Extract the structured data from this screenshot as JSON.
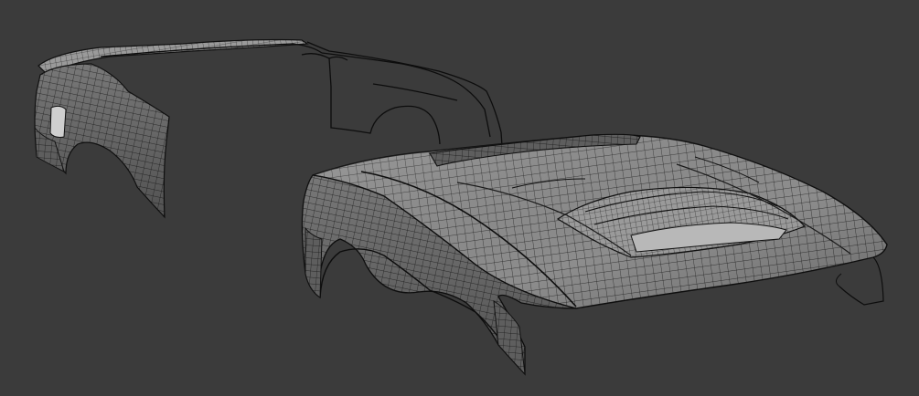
{
  "viewport": {
    "background": "#3b3b3b",
    "mesh_fill": "#8a8a8a",
    "mesh_fill_light": "#a6a6a6",
    "mesh_fill_dark": "#5a5a5a",
    "wire_color": "#1a1a1a"
  },
  "objects": [
    {
      "name": "rear-body-panel-mesh"
    },
    {
      "name": "rear-body-outline"
    },
    {
      "name": "front-hood-fender-mesh"
    }
  ]
}
